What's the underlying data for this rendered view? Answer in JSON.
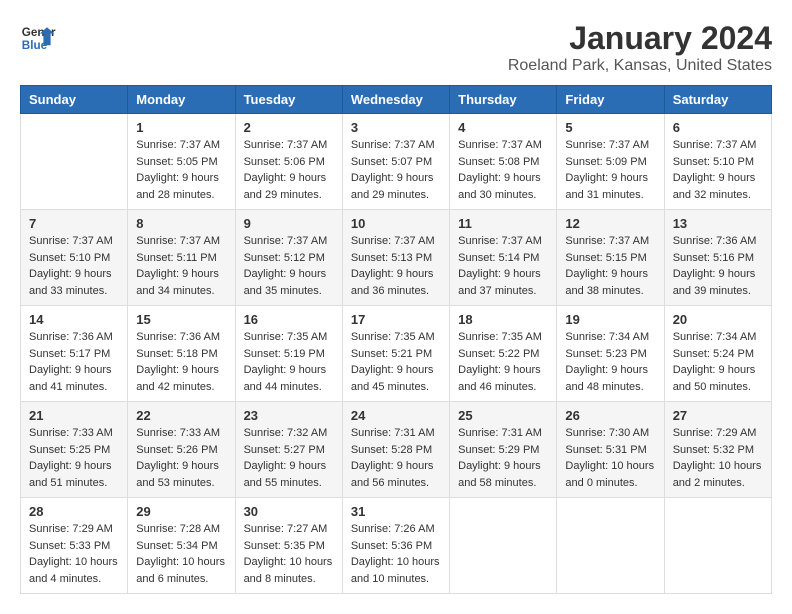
{
  "logo": {
    "line1": "General",
    "line2": "Blue"
  },
  "title": "January 2024",
  "subtitle": "Roeland Park, Kansas, United States",
  "headers": [
    "Sunday",
    "Monday",
    "Tuesday",
    "Wednesday",
    "Thursday",
    "Friday",
    "Saturday"
  ],
  "weeks": [
    [
      {
        "day": "",
        "sunrise": "",
        "sunset": "",
        "daylight": ""
      },
      {
        "day": "1",
        "sunrise": "Sunrise: 7:37 AM",
        "sunset": "Sunset: 5:05 PM",
        "daylight": "Daylight: 9 hours and 28 minutes."
      },
      {
        "day": "2",
        "sunrise": "Sunrise: 7:37 AM",
        "sunset": "Sunset: 5:06 PM",
        "daylight": "Daylight: 9 hours and 29 minutes."
      },
      {
        "day": "3",
        "sunrise": "Sunrise: 7:37 AM",
        "sunset": "Sunset: 5:07 PM",
        "daylight": "Daylight: 9 hours and 29 minutes."
      },
      {
        "day": "4",
        "sunrise": "Sunrise: 7:37 AM",
        "sunset": "Sunset: 5:08 PM",
        "daylight": "Daylight: 9 hours and 30 minutes."
      },
      {
        "day": "5",
        "sunrise": "Sunrise: 7:37 AM",
        "sunset": "Sunset: 5:09 PM",
        "daylight": "Daylight: 9 hours and 31 minutes."
      },
      {
        "day": "6",
        "sunrise": "Sunrise: 7:37 AM",
        "sunset": "Sunset: 5:10 PM",
        "daylight": "Daylight: 9 hours and 32 minutes."
      }
    ],
    [
      {
        "day": "7",
        "sunrise": "Sunrise: 7:37 AM",
        "sunset": "Sunset: 5:10 PM",
        "daylight": "Daylight: 9 hours and 33 minutes."
      },
      {
        "day": "8",
        "sunrise": "Sunrise: 7:37 AM",
        "sunset": "Sunset: 5:11 PM",
        "daylight": "Daylight: 9 hours and 34 minutes."
      },
      {
        "day": "9",
        "sunrise": "Sunrise: 7:37 AM",
        "sunset": "Sunset: 5:12 PM",
        "daylight": "Daylight: 9 hours and 35 minutes."
      },
      {
        "day": "10",
        "sunrise": "Sunrise: 7:37 AM",
        "sunset": "Sunset: 5:13 PM",
        "daylight": "Daylight: 9 hours and 36 minutes."
      },
      {
        "day": "11",
        "sunrise": "Sunrise: 7:37 AM",
        "sunset": "Sunset: 5:14 PM",
        "daylight": "Daylight: 9 hours and 37 minutes."
      },
      {
        "day": "12",
        "sunrise": "Sunrise: 7:37 AM",
        "sunset": "Sunset: 5:15 PM",
        "daylight": "Daylight: 9 hours and 38 minutes."
      },
      {
        "day": "13",
        "sunrise": "Sunrise: 7:36 AM",
        "sunset": "Sunset: 5:16 PM",
        "daylight": "Daylight: 9 hours and 39 minutes."
      }
    ],
    [
      {
        "day": "14",
        "sunrise": "Sunrise: 7:36 AM",
        "sunset": "Sunset: 5:17 PM",
        "daylight": "Daylight: 9 hours and 41 minutes."
      },
      {
        "day": "15",
        "sunrise": "Sunrise: 7:36 AM",
        "sunset": "Sunset: 5:18 PM",
        "daylight": "Daylight: 9 hours and 42 minutes."
      },
      {
        "day": "16",
        "sunrise": "Sunrise: 7:35 AM",
        "sunset": "Sunset: 5:19 PM",
        "daylight": "Daylight: 9 hours and 44 minutes."
      },
      {
        "day": "17",
        "sunrise": "Sunrise: 7:35 AM",
        "sunset": "Sunset: 5:21 PM",
        "daylight": "Daylight: 9 hours and 45 minutes."
      },
      {
        "day": "18",
        "sunrise": "Sunrise: 7:35 AM",
        "sunset": "Sunset: 5:22 PM",
        "daylight": "Daylight: 9 hours and 46 minutes."
      },
      {
        "day": "19",
        "sunrise": "Sunrise: 7:34 AM",
        "sunset": "Sunset: 5:23 PM",
        "daylight": "Daylight: 9 hours and 48 minutes."
      },
      {
        "day": "20",
        "sunrise": "Sunrise: 7:34 AM",
        "sunset": "Sunset: 5:24 PM",
        "daylight": "Daylight: 9 hours and 50 minutes."
      }
    ],
    [
      {
        "day": "21",
        "sunrise": "Sunrise: 7:33 AM",
        "sunset": "Sunset: 5:25 PM",
        "daylight": "Daylight: 9 hours and 51 minutes."
      },
      {
        "day": "22",
        "sunrise": "Sunrise: 7:33 AM",
        "sunset": "Sunset: 5:26 PM",
        "daylight": "Daylight: 9 hours and 53 minutes."
      },
      {
        "day": "23",
        "sunrise": "Sunrise: 7:32 AM",
        "sunset": "Sunset: 5:27 PM",
        "daylight": "Daylight: 9 hours and 55 minutes."
      },
      {
        "day": "24",
        "sunrise": "Sunrise: 7:31 AM",
        "sunset": "Sunset: 5:28 PM",
        "daylight": "Daylight: 9 hours and 56 minutes."
      },
      {
        "day": "25",
        "sunrise": "Sunrise: 7:31 AM",
        "sunset": "Sunset: 5:29 PM",
        "daylight": "Daylight: 9 hours and 58 minutes."
      },
      {
        "day": "26",
        "sunrise": "Sunrise: 7:30 AM",
        "sunset": "Sunset: 5:31 PM",
        "daylight": "Daylight: 10 hours and 0 minutes."
      },
      {
        "day": "27",
        "sunrise": "Sunrise: 7:29 AM",
        "sunset": "Sunset: 5:32 PM",
        "daylight": "Daylight: 10 hours and 2 minutes."
      }
    ],
    [
      {
        "day": "28",
        "sunrise": "Sunrise: 7:29 AM",
        "sunset": "Sunset: 5:33 PM",
        "daylight": "Daylight: 10 hours and 4 minutes."
      },
      {
        "day": "29",
        "sunrise": "Sunrise: 7:28 AM",
        "sunset": "Sunset: 5:34 PM",
        "daylight": "Daylight: 10 hours and 6 minutes."
      },
      {
        "day": "30",
        "sunrise": "Sunrise: 7:27 AM",
        "sunset": "Sunset: 5:35 PM",
        "daylight": "Daylight: 10 hours and 8 minutes."
      },
      {
        "day": "31",
        "sunrise": "Sunrise: 7:26 AM",
        "sunset": "Sunset: 5:36 PM",
        "daylight": "Daylight: 10 hours and 10 minutes."
      },
      {
        "day": "",
        "sunrise": "",
        "sunset": "",
        "daylight": ""
      },
      {
        "day": "",
        "sunrise": "",
        "sunset": "",
        "daylight": ""
      },
      {
        "day": "",
        "sunrise": "",
        "sunset": "",
        "daylight": ""
      }
    ]
  ]
}
